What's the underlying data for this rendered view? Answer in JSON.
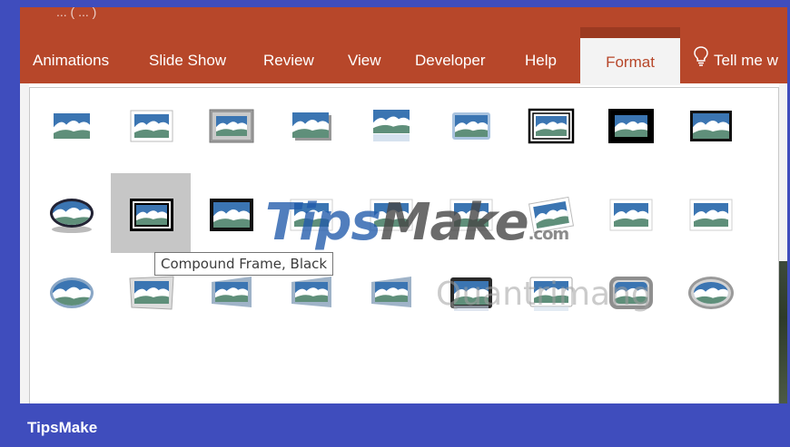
{
  "window": {
    "title_fragment": "... ( ... )"
  },
  "ribbon": {
    "tabs": [
      {
        "label": "Animations"
      },
      {
        "label": "Slide Show"
      },
      {
        "label": "Review"
      },
      {
        "label": "View"
      },
      {
        "label": "Developer"
      },
      {
        "label": "Help"
      },
      {
        "label": "Format",
        "active": true
      }
    ],
    "tell_me": "Tell me w",
    "color": "#b7472a"
  },
  "gallery": {
    "styles": [
      "Simple Frame, White",
      "Beveled Matte, White",
      "Metal Frame",
      "Drop Shadow Rectangle",
      "Reflected Rounded Rectangle",
      "Soft Edge Rectangle",
      "Double Frame, Black",
      "Thick Matte, Black",
      "Simple Frame, Black",
      "Beveled Oval, Black",
      "Compound Frame, Black",
      "Center Shadow Rectangle",
      "Rounded Diagonal Corner, White",
      "Snip Diagonal Corner, White",
      "Moderate Frame, White",
      "Rotated, White",
      "Perspective Shadow, White",
      "Relaxed Perspective, White",
      "Soft Edge Oval",
      "Bevel Rectangle",
      "Bevel Perspective",
      "Reflected Perspective Right",
      "Bevel Perspective Left, White",
      "Reflected Bevel, Black",
      "Reflected Bevel, White",
      "Metal Rounded Rectangle",
      "Metal Oval"
    ],
    "selected_index": 10
  },
  "tooltip": {
    "text": "Compound Frame, Black"
  },
  "watermark": {
    "tips": "Tips",
    "make": "Make",
    "com": ".com",
    "secondary": "Quantrimang"
  },
  "footer": {
    "label": "TipsMake"
  }
}
